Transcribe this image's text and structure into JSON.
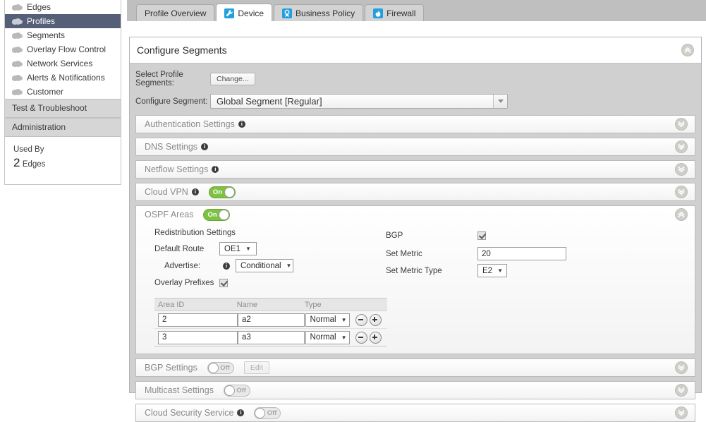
{
  "sidebar": {
    "nav_items": [
      {
        "label": "Edges",
        "selected": false
      },
      {
        "label": "Profiles",
        "selected": true
      },
      {
        "label": "Segments",
        "selected": false
      },
      {
        "label": "Overlay Flow Control",
        "selected": false
      },
      {
        "label": "Network Services",
        "selected": false
      },
      {
        "label": "Alerts & Notifications",
        "selected": false
      },
      {
        "label": "Customer",
        "selected": false
      }
    ],
    "sections": [
      {
        "label": "Test & Troubleshoot"
      },
      {
        "label": "Administration"
      }
    ],
    "used_by": {
      "title": "Used By",
      "count": "2",
      "unit": "Edges"
    }
  },
  "tabs": [
    {
      "label": "Profile Overview",
      "icon": "none",
      "active": false
    },
    {
      "label": "Device",
      "icon": "wrench-icon",
      "active": true
    },
    {
      "label": "Business Policy",
      "icon": "badge-icon",
      "active": false
    },
    {
      "label": "Firewall",
      "icon": "flame-icon",
      "active": false
    }
  ],
  "panel": {
    "title": "Configure Segments",
    "collapse_icon": "double-chevron-up-icon",
    "select_profile_segments_label": "Select Profile Segments:",
    "change_button": "Change...",
    "configure_segment_label": "Configure Segment:",
    "configure_segment_value": "Global Segment [Regular]"
  },
  "sections": [
    {
      "id": "authentication-settings",
      "name": "Authentication Settings",
      "info": true,
      "toggle": null,
      "expanded": false,
      "chevron": "double-chevron-down-icon"
    },
    {
      "id": "dns-settings",
      "name": "DNS Settings",
      "info": true,
      "toggle": null,
      "expanded": false,
      "chevron": "double-chevron-down-icon"
    },
    {
      "id": "netflow-settings",
      "name": "Netflow Settings",
      "info": true,
      "toggle": null,
      "expanded": false,
      "chevron": "double-chevron-down-icon"
    },
    {
      "id": "cloud-vpn",
      "name": "Cloud VPN",
      "info": true,
      "toggle": {
        "state": "on",
        "label": "On"
      },
      "expanded": false,
      "chevron": "double-chevron-down-icon"
    },
    {
      "id": "ospf-areas",
      "name": "OSPF Areas",
      "info": false,
      "toggle": {
        "state": "on",
        "label": "On"
      },
      "expanded": true,
      "chevron": "double-chevron-up-icon"
    },
    {
      "id": "bgp-settings",
      "name": "BGP Settings",
      "info": false,
      "toggle": {
        "state": "off",
        "label": "Off"
      },
      "edit_button": "Edit",
      "expanded": false,
      "chevron": "double-chevron-down-icon"
    },
    {
      "id": "multicast-settings",
      "name": "Multicast Settings",
      "info": false,
      "toggle": {
        "state": "off",
        "label": "Off"
      },
      "expanded": false,
      "chevron": "double-chevron-down-icon"
    },
    {
      "id": "cloud-security-service",
      "name": "Cloud Security Service",
      "info": true,
      "toggle": {
        "state": "off",
        "label": "Off"
      },
      "expanded": false,
      "chevron": "double-chevron-down-icon"
    }
  ],
  "ospf": {
    "redistribution_title": "Redistribution Settings",
    "default_route_label": "Default Route",
    "default_route_value": "OE1",
    "advertise_label": "Advertise:",
    "advertise_value": "Conditional",
    "overlay_prefixes_label": "Overlay Prefixes",
    "overlay_prefixes_checked": true,
    "bgp_label": "BGP",
    "bgp_checked": true,
    "set_metric_label": "Set Metric",
    "set_metric_value": "20",
    "set_metric_type_label": "Set Metric Type",
    "set_metric_type_value": "E2",
    "table": {
      "columns": [
        "Area ID",
        "Name",
        "Type"
      ],
      "rows": [
        {
          "area_id": "2",
          "name": "a2",
          "type": "Normal"
        },
        {
          "area_id": "3",
          "name": "a3",
          "type": "Normal"
        }
      ]
    }
  },
  "colors": {
    "selected_nav": "#555f77",
    "toggle_on": "#7dc242",
    "tab_icon": "#21a0e0",
    "panel_bg": "#d0d0d0"
  }
}
